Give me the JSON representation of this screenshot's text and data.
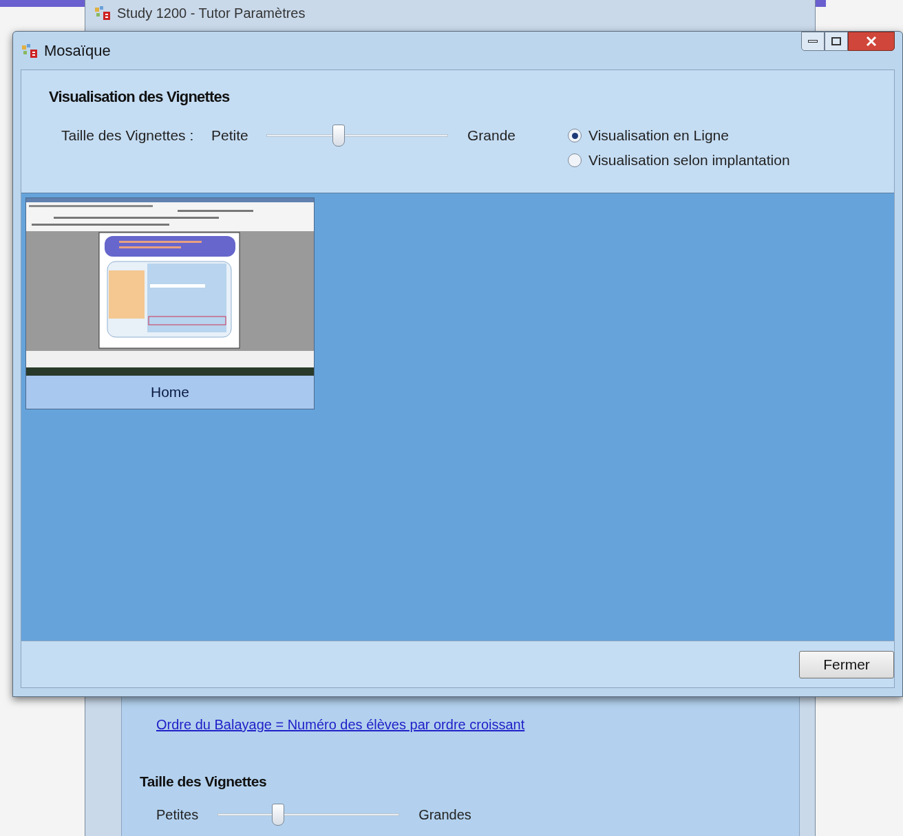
{
  "background_window": {
    "title": "Study 1200 - Tutor Paramètres",
    "link": "Ordre du Balayage = Numéro des élèves par ordre croissant",
    "size_heading": "Taille des Vignettes",
    "slider": {
      "min_label": "Petites",
      "max_label": "Grandes",
      "level": 0.32
    }
  },
  "dialog": {
    "title": "Mosaïque",
    "heading": "Visualisation des Vignettes",
    "size_label": "Taille des Vignettes :",
    "slider": {
      "min_label": "Petite",
      "max_label": "Grande",
      "level": 0.39
    },
    "view_options": [
      {
        "label": "Visualisation en Ligne",
        "selected": true
      },
      {
        "label": "Visualisation selon implantation",
        "selected": false
      }
    ],
    "thumbnails": [
      {
        "caption": "Home"
      }
    ],
    "close_button": "Fermer"
  }
}
